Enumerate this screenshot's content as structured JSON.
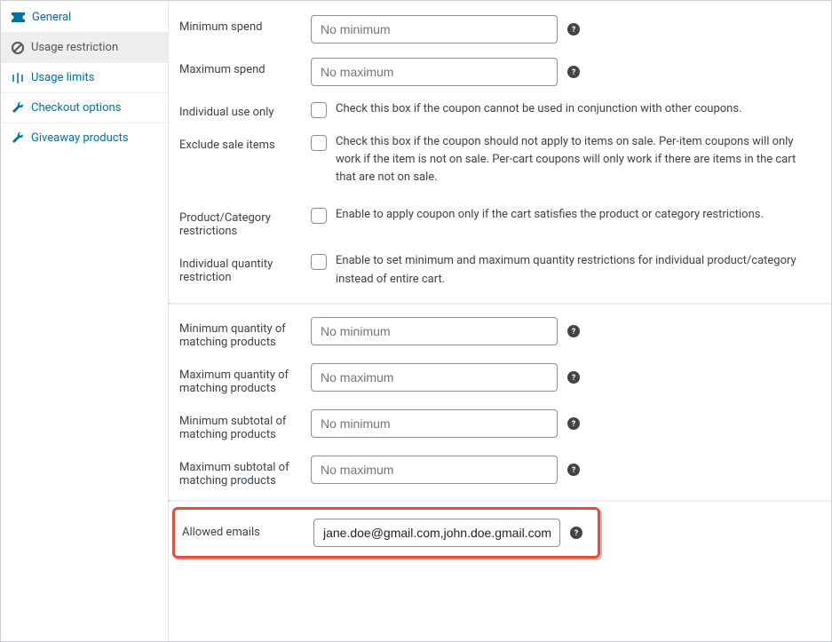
{
  "sidebar": {
    "items": [
      {
        "label": "General"
      },
      {
        "label": "Usage restriction"
      },
      {
        "label": "Usage limits"
      },
      {
        "label": "Checkout options"
      },
      {
        "label": "Giveaway products"
      }
    ]
  },
  "fields": {
    "min_spend": {
      "label": "Minimum spend",
      "placeholder": "No minimum"
    },
    "max_spend": {
      "label": "Maximum spend",
      "placeholder": "No maximum"
    },
    "individual_use": {
      "label": "Individual use only",
      "desc": "Check this box if the coupon cannot be used in conjunction with other coupons."
    },
    "exclude_sale": {
      "label": "Exclude sale items",
      "desc": "Check this box if the coupon should not apply to items on sale. Per-item coupons will only work if the item is not on sale. Per-cart coupons will only work if there are items in the cart that are not on sale."
    },
    "prod_cat_restrict": {
      "label": "Product/Category restrictions",
      "desc": "Enable to apply coupon only if the cart satisfies the product or category restrictions."
    },
    "ind_qty_restrict": {
      "label": "Individual quantity restriction",
      "desc": "Enable to set minimum and maximum quantity restrictions for individual product/category instead of entire cart."
    },
    "min_qty": {
      "label": "Minimum quantity of matching products",
      "placeholder": "No minimum"
    },
    "max_qty": {
      "label": "Maximum quantity of matching products",
      "placeholder": "No maximum"
    },
    "min_sub": {
      "label": "Minimum subtotal of matching products",
      "placeholder": "No minimum"
    },
    "max_sub": {
      "label": "Maximum subtotal of matching products",
      "placeholder": "No maximum"
    },
    "allowed_emails": {
      "label": "Allowed emails",
      "value": "jane.doe@gmail.com,john.doe.gmail.com,"
    }
  }
}
